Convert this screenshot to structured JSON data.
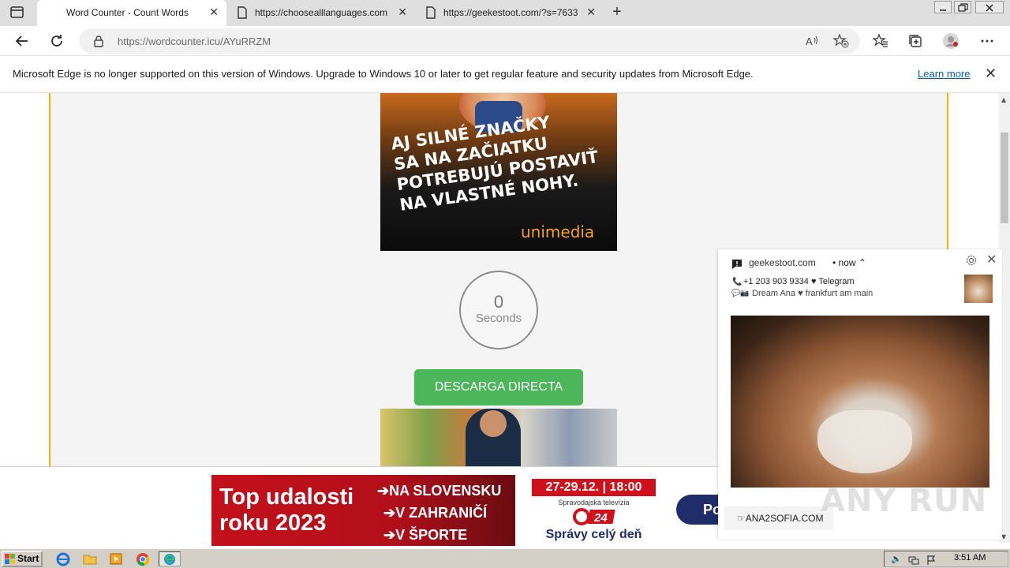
{
  "browser": {
    "tabs": [
      {
        "title": "Word Counter - Count Words",
        "active": true
      },
      {
        "title": "https://choosealllanguages.com/",
        "active": false
      },
      {
        "title": "https://geekestoot.com/?s=7633",
        "active": false
      }
    ],
    "url": {
      "host": "https://wordcounter.icu",
      "path": "/AYuRRZM"
    }
  },
  "infobar": {
    "message": "Microsoft Edge is no longer supported on this version of Windows. Upgrade to Windows 10 or later to get regular feature and security updates from Microsoft Edge.",
    "link": "Learn more"
  },
  "page": {
    "ad_top": {
      "lines": [
        "AJ SILNÉ ZNAČKY",
        "SA NA ZAČIATKU",
        "POTREBUJÚ POSTAVIŤ",
        "NA VLASTNÉ NOHY."
      ],
      "brand": "unimedia"
    },
    "timer": {
      "value": "0",
      "unit": "Seconds"
    },
    "download_button": "DESCARGA DIRECTA"
  },
  "bottom_ad": {
    "title_line1": "Top udalosti",
    "title_line2": "roku 2023",
    "points": [
      "➔NA SLOVENSKU",
      "➔V ZAHRANIČÍ",
      "➔V ŠPORTE"
    ],
    "date": "27-29.12. | 18:00",
    "channel": "Spravodajská televízia",
    "logo": "24",
    "tagline": "Správy celý deň",
    "cta": "Po"
  },
  "notification": {
    "site": "geekestoot.com",
    "time": "• now ⌃",
    "line1": "+1 203 903 9334 ♥ Telegram",
    "line2": "Dream Ana ♥ frankfurt am main",
    "footer": "☞ANA2SOFIA.COM"
  },
  "watermark": "ANY RUN",
  "taskbar": {
    "start": "Start",
    "clock": "3:51 AM"
  },
  "colors": {
    "accent_border": "#f0b400",
    "download_green": "#4cb75a",
    "link_blue": "#0b5cad"
  }
}
